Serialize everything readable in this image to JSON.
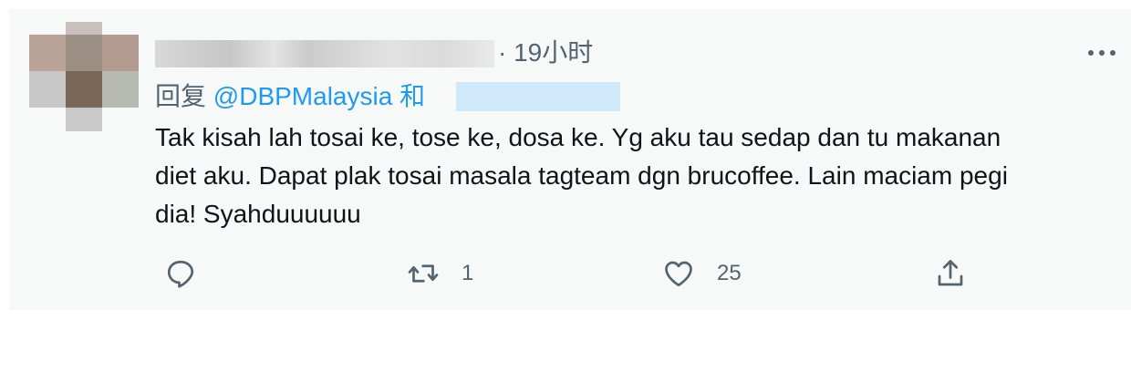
{
  "tweet": {
    "time_separator": "·",
    "time": "19小时",
    "more_icon": "more-horizontal-icon",
    "reply_prefix": "回复",
    "reply_mention": "@DBPMalaysia",
    "reply_and": "和",
    "text_lines": [
      "Tak kisah lah tosai ke, tose ke, dosa ke. Yg aku tau sedap dan tu makanan",
      "diet aku. Dapat plak tosai masala tagteam dgn brucoffee. Lain maciam pegi",
      "dia! Syahduuuuuu"
    ],
    "actions": {
      "reply": {
        "icon": "reply-icon",
        "count": ""
      },
      "retweet": {
        "icon": "retweet-icon",
        "count": "1"
      },
      "like": {
        "icon": "heart-icon",
        "count": "25"
      },
      "share": {
        "icon": "share-icon",
        "count": ""
      }
    },
    "colors": {
      "background": "#f7f9f9",
      "text": "#0f1419",
      "secondary": "#536471",
      "accent": "#1d9bf0"
    }
  }
}
